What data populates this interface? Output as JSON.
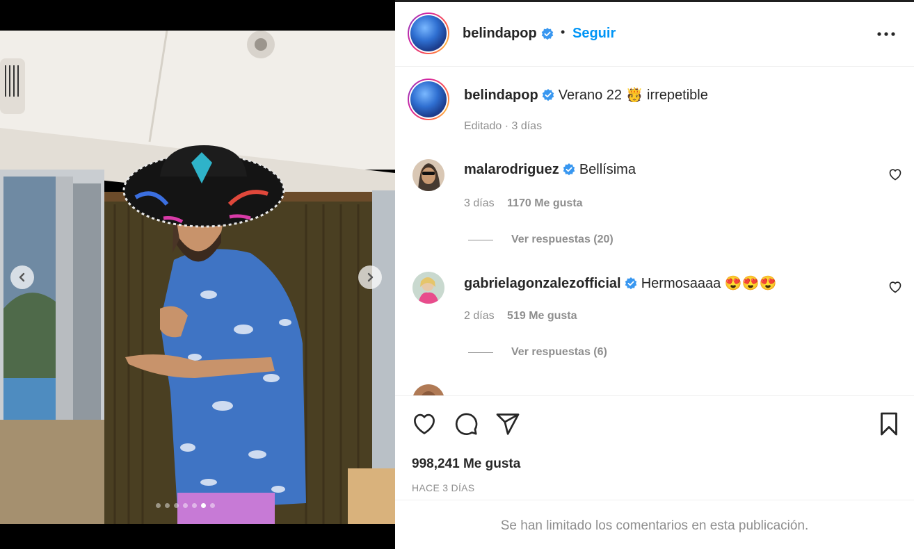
{
  "post": {
    "author": "belindapop",
    "follow_label": "Seguir",
    "separator": "•",
    "caption_text": "Verano 22 🫅 irrepetible",
    "caption_meta": "Editado · 3 días",
    "likes": "998,241 Me gusta",
    "date": "HACE 3 DÍAS",
    "comments_limited": "Se han limitado los comentarios en esta publicación.",
    "carousel": {
      "slide_count": 7,
      "active_index": 5
    }
  },
  "comments": [
    {
      "username": "malarodriguez",
      "text": "Bellísima",
      "age": "3 días",
      "likes": "1170 Me gusta",
      "replies": "Ver respuestas (20)"
    },
    {
      "username": "gabrielagonzalezofficial",
      "text": "Hermosaaaa 😍😍😍",
      "age": "2 días",
      "likes": "519 Me gusta",
      "replies": "Ver respuestas (6)"
    }
  ],
  "colors": {
    "accent": "#0095f6",
    "verified": "#3897f0",
    "muted": "#8e8e8e",
    "text": "#262626"
  },
  "icons": [
    "verified-badge-icon",
    "more-options-icon",
    "heart-icon",
    "comment-icon",
    "share-icon",
    "bookmark-icon",
    "chevron-left-icon",
    "chevron-right-icon"
  ]
}
